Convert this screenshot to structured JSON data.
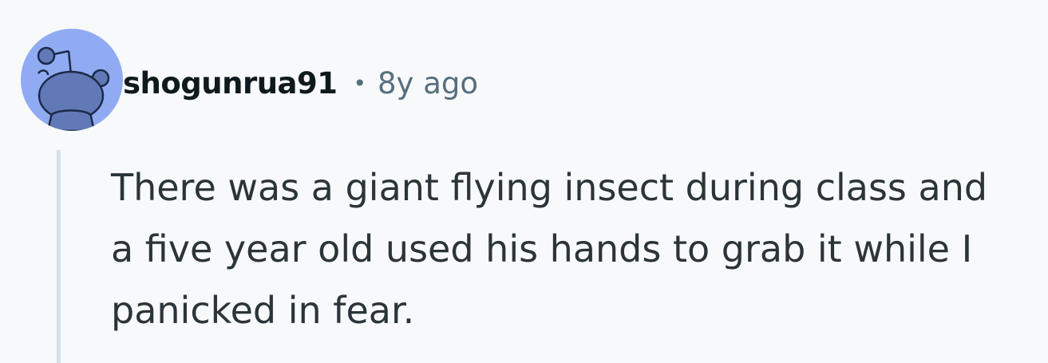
{
  "comment": {
    "username": "shogunrua91",
    "separator": "•",
    "timestamp": "8y ago",
    "avatar_icon": "snoo-avatar-icon",
    "body_lines": [
      "There was a giant flying insect during class and",
      "a five year old used his hands to grab it while I",
      "panicked in fear."
    ]
  },
  "colors": {
    "background": "#f8f9fb",
    "avatar_bg": "#90abf2",
    "avatar_figure": "#6279b8",
    "username": "#0f1a1c",
    "meta_gray": "#55707d",
    "thread_line": "#d6e1ea",
    "body_text": "#2b3538"
  }
}
